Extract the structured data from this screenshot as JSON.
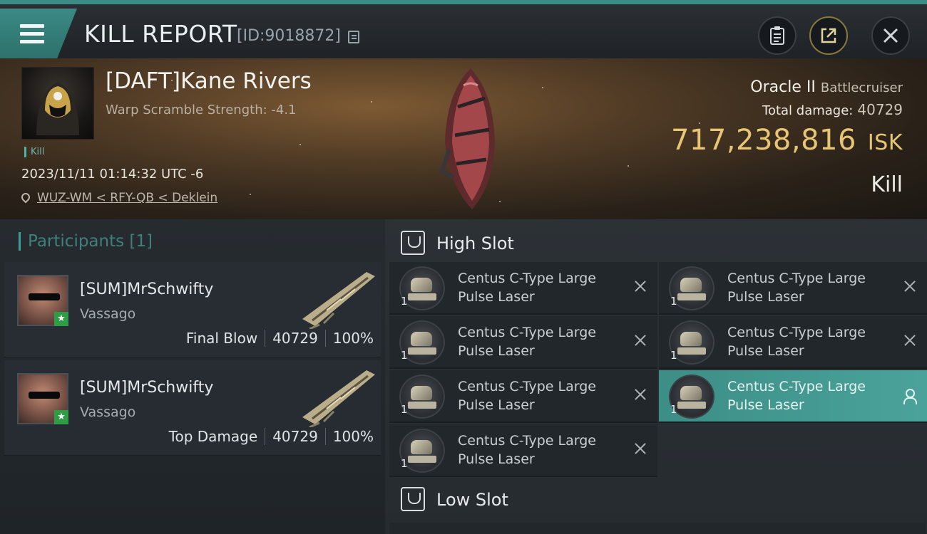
{
  "header": {
    "title": "KILL REPORT",
    "report_id": "[ID:9018872]",
    "buttons": [
      "clipboard-icon",
      "share-icon",
      "close-icon"
    ]
  },
  "victim": {
    "name": "[DAFT]Kane Rivers",
    "warp_scramble": "Warp Scramble Strength: -4.1",
    "kill_tag": "Kill",
    "datetime": "2023/11/11 01:14:32 UTC -6",
    "location": "WUZ-WM < RFY-QB < Deklein",
    "ship": "Oracle II",
    "ship_class": "Battlecruiser",
    "total_damage_label": "Total damage:",
    "total_damage": "40729",
    "isk_value": "717,238,816",
    "isk_unit": "ISK",
    "result": "Kill"
  },
  "participants": {
    "title": "Participants",
    "count": "[1]",
    "list": [
      {
        "name": "[SUM]MrSchwifty",
        "corp": "Vassago",
        "role": "Final Blow",
        "damage": "40729",
        "percent": "100%"
      },
      {
        "name": "[SUM]MrSchwifty",
        "corp": "Vassago",
        "role": "Top Damage",
        "damage": "40729",
        "percent": "100%"
      }
    ]
  },
  "fitting": {
    "high_slot": "High Slot",
    "low_slot": "Low Slot",
    "items": [
      {
        "name": "Centus C-Type Large Pulse Laser",
        "qty": "1"
      },
      {
        "name": "Centus C-Type Large Pulse Laser",
        "qty": "1"
      },
      {
        "name": "Centus C-Type Large Pulse Laser",
        "qty": "1"
      },
      {
        "name": "Centus C-Type Large Pulse Laser",
        "qty": "1"
      },
      {
        "name": "Centus C-Type Large Pulse Laser",
        "qty": "1"
      },
      {
        "name": "Centus C-Type Large Pulse Laser",
        "qty": "1"
      },
      {
        "name": "Centus C-Type Large Pulse Laser",
        "qty": "1"
      }
    ]
  },
  "colors": {
    "accent": "#3c8c86",
    "isk": "#e8c575"
  }
}
